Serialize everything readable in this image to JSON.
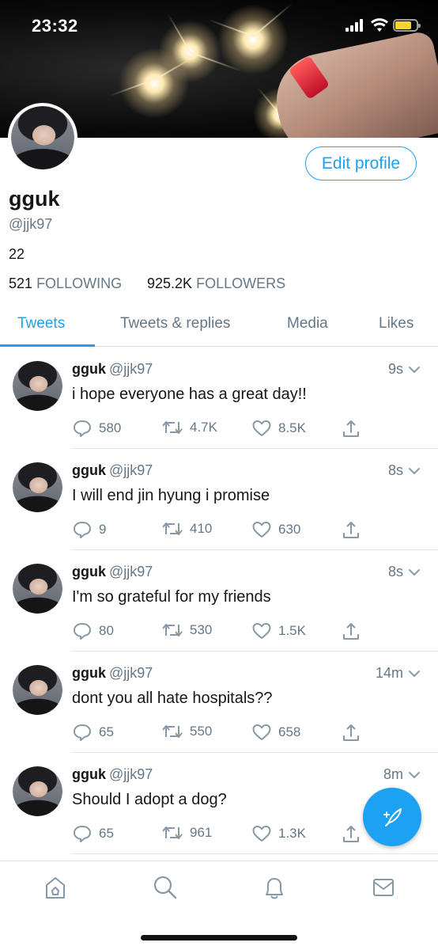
{
  "status_bar": {
    "time": "23:32"
  },
  "profile": {
    "name": "gguk",
    "handle": "@jjk97",
    "bio": "22",
    "following_count": "521",
    "following_label": "FOLLOWING",
    "followers_count": "925.2K",
    "followers_label": "FOLLOWERS",
    "edit_button": "Edit profile"
  },
  "tabs": [
    {
      "label": "Tweets",
      "active": true
    },
    {
      "label": "Tweets & replies"
    },
    {
      "label": "Media"
    },
    {
      "label": "Likes"
    }
  ],
  "tweets": [
    {
      "name": "gguk",
      "handle": "@jjk97",
      "time": "9s",
      "text": "i hope everyone has a great day!!",
      "replies": "580",
      "retweets": "4.7K",
      "likes": "8.5K"
    },
    {
      "name": "gguk",
      "handle": "@jjk97",
      "time": "8s",
      "text": "I will end jin hyung i promise",
      "replies": "9",
      "retweets": "410",
      "likes": "630"
    },
    {
      "name": "gguk",
      "handle": "@jjk97",
      "time": "8s",
      "text": "I'm so grateful for my friends",
      "replies": "80",
      "retweets": "530",
      "likes": "1.5K"
    },
    {
      "name": "gguk",
      "handle": "@jjk97",
      "time": "14m",
      "text": "dont you all hate hospitals??",
      "replies": "65",
      "retweets": "550",
      "likes": "658"
    },
    {
      "name": "gguk",
      "handle": "@jjk97",
      "time": "8m",
      "text": "Should I adopt a dog?",
      "replies": "65",
      "retweets": "961",
      "likes": "1.3K"
    }
  ],
  "colors": {
    "accent": "#1da1f2",
    "muted": "#657786",
    "text": "#14171a"
  },
  "icons": {
    "reply": "reply-icon",
    "retweet": "retweet-icon",
    "like": "heart-icon",
    "share": "share-icon",
    "compose": "compose-tweet-icon",
    "home": "home-icon",
    "search": "search-icon",
    "notifications": "bell-icon",
    "messages": "mail-icon"
  }
}
